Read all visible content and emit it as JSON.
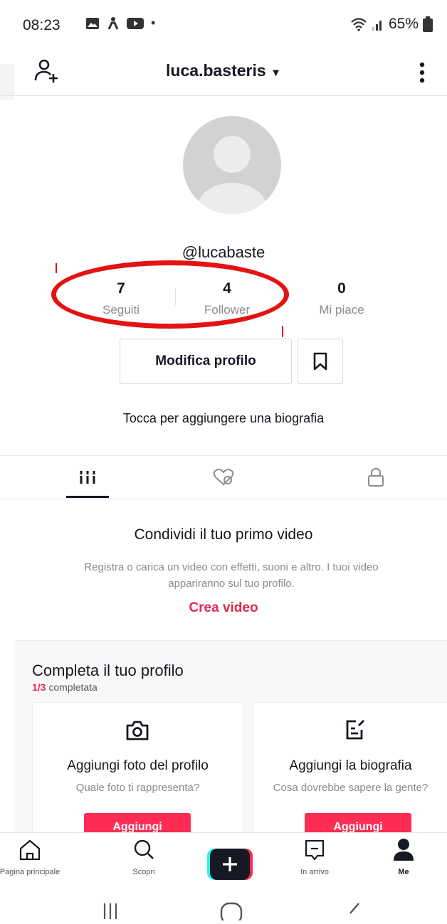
{
  "status_bar": {
    "time": "08:23",
    "battery": "65%"
  },
  "header": {
    "username": "luca.basteris"
  },
  "profile": {
    "handle": "@lucabaste",
    "stats": [
      {
        "value": "7",
        "label": "Seguiti"
      },
      {
        "value": "4",
        "label": "Follower"
      },
      {
        "value": "0",
        "label": "Mi piace"
      }
    ],
    "edit_label": "Modifica profilo",
    "bio_prompt": "Tocca per aggiungere una biografia"
  },
  "empty_state": {
    "title": "Condividi il tuo primo video",
    "description": "Registra o carica un video con effetti, suoni e altro. I tuoi video appariranno sul tuo profilo.",
    "cta": "Crea video"
  },
  "complete_profile": {
    "title": "Completa il tuo profilo",
    "progress": "1/3",
    "progress_suffix": "completata",
    "cards": [
      {
        "title": "Aggiungi foto del profilo",
        "desc": "Quale foto ti rappresenta?",
        "button": "Aggiungi",
        "icon": "camera-icon"
      },
      {
        "title": "Aggiungi la biografia",
        "desc": "Cosa dovrebbe sapere la gente?",
        "button": "Aggiungi",
        "icon": "edit-note-icon"
      }
    ]
  },
  "navbar": {
    "items": [
      {
        "label": "Pagina principale",
        "icon": "home-icon"
      },
      {
        "label": "Scopri",
        "icon": "search-icon"
      },
      {
        "label": "",
        "icon": "plus-icon"
      },
      {
        "label": "In arrivo",
        "icon": "inbox-icon"
      },
      {
        "label": "Me",
        "icon": "person-icon"
      }
    ]
  },
  "colors": {
    "accent": "#fe2c55",
    "annotation": "#e41313"
  }
}
